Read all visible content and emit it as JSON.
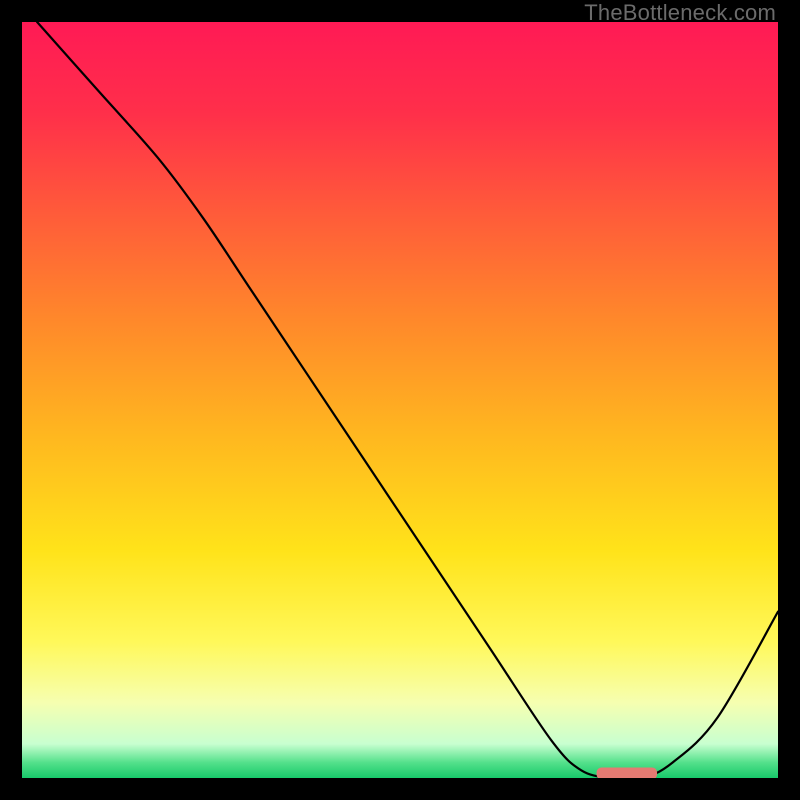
{
  "watermark": "TheBottleneck.com",
  "chart_data": {
    "type": "line",
    "title": "",
    "xlabel": "",
    "ylabel": "",
    "xlim": [
      0,
      100
    ],
    "ylim": [
      0,
      100
    ],
    "grid": false,
    "series": [
      {
        "name": "curve",
        "x": [
          2,
          10,
          18,
          24,
          30,
          38,
          46,
          54,
          62,
          70,
          74,
          78,
          82,
          86,
          92,
          100
        ],
        "y": [
          100,
          91,
          82,
          74,
          65,
          53,
          41,
          29,
          17,
          5,
          1,
          0,
          0,
          2,
          8,
          22
        ]
      }
    ],
    "marker": {
      "name": "optimum-marker",
      "x_start": 76,
      "x_end": 84,
      "y": 0.6,
      "color": "#e47a72"
    },
    "gradient_stops": [
      {
        "pos": 0.0,
        "color": "#ff1a55"
      },
      {
        "pos": 0.12,
        "color": "#ff2f4a"
      },
      {
        "pos": 0.25,
        "color": "#ff5a3a"
      },
      {
        "pos": 0.4,
        "color": "#ff8a2a"
      },
      {
        "pos": 0.55,
        "color": "#ffb81f"
      },
      {
        "pos": 0.7,
        "color": "#ffe31a"
      },
      {
        "pos": 0.82,
        "color": "#fff85a"
      },
      {
        "pos": 0.9,
        "color": "#f6ffb0"
      },
      {
        "pos": 0.955,
        "color": "#c8ffd0"
      },
      {
        "pos": 0.98,
        "color": "#52e08a"
      },
      {
        "pos": 1.0,
        "color": "#18c96b"
      }
    ]
  }
}
